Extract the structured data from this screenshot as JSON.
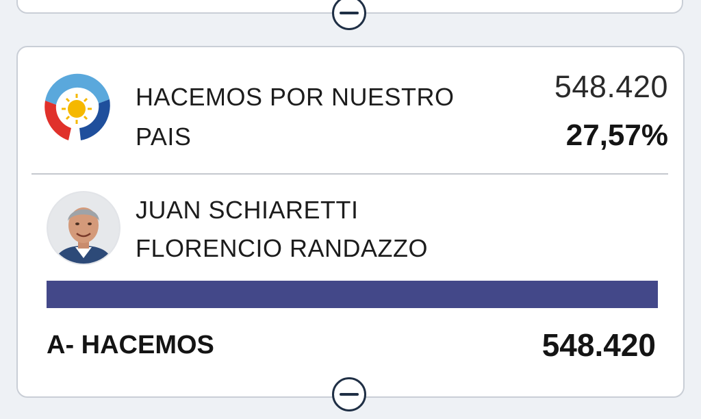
{
  "party": {
    "name": "HACEMOS POR NUESTRO PAIS",
    "votes": "548.420",
    "percent": "27,57%",
    "logo_icon": "hacemos-argentina-logo-icon"
  },
  "candidates": {
    "governor": "JUAN SCHIARETTI",
    "vice": "FLORENCIO RANDAZZO",
    "avatar_icon": "candidate-avatar"
  },
  "list": {
    "label": "A- HACEMOS",
    "votes": "548.420",
    "bar_fraction": 1.0,
    "bar_color": "#434889"
  },
  "controls": {
    "collapse_icon": "minus-circle-icon"
  }
}
